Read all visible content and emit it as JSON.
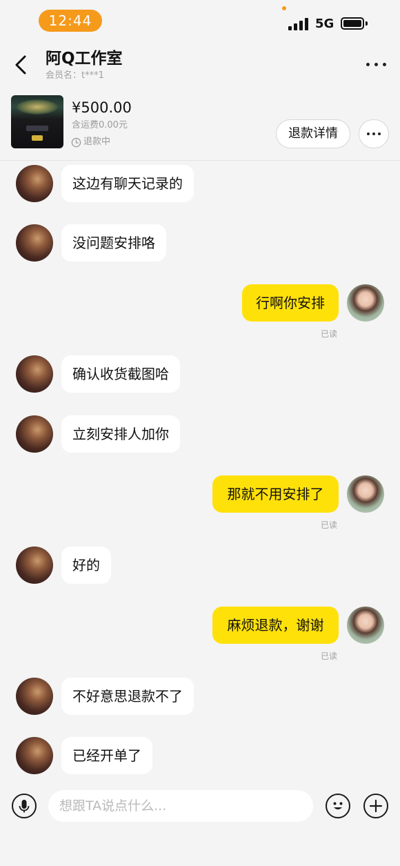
{
  "status_bar": {
    "time": "12:44",
    "network": "5G"
  },
  "header": {
    "title": "阿Q工作室",
    "member": "会员名：t***1"
  },
  "product": {
    "price": "¥500.00",
    "shipping": "含运费0.00元",
    "status": "退款中",
    "refund_button": "退款详情"
  },
  "messages": [
    {
      "side": "left",
      "text": "这边有聊天记录的"
    },
    {
      "side": "left",
      "text": "没问题安排咯"
    },
    {
      "side": "right",
      "text": "行啊你安排",
      "read": "已读"
    },
    {
      "side": "left",
      "text": "确认收货截图哈"
    },
    {
      "side": "left",
      "text": "立刻安排人加你"
    },
    {
      "side": "right",
      "text": "那就不用安排了",
      "read": "已读"
    },
    {
      "side": "left",
      "text": "好的"
    },
    {
      "side": "right",
      "text": "麻烦退款，谢谢",
      "read": "已读"
    },
    {
      "side": "left",
      "text": "不好意思退款不了"
    },
    {
      "side": "left",
      "text": "已经开单了"
    }
  ],
  "input": {
    "placeholder": "想跟TA说点什么..."
  },
  "icons": [
    "back-icon",
    "more-icon",
    "clock-icon",
    "mic-icon",
    "emoji-icon",
    "plus-icon"
  ],
  "colors": {
    "accent": "#ffe10a",
    "status_pill": "#f59a1b"
  }
}
